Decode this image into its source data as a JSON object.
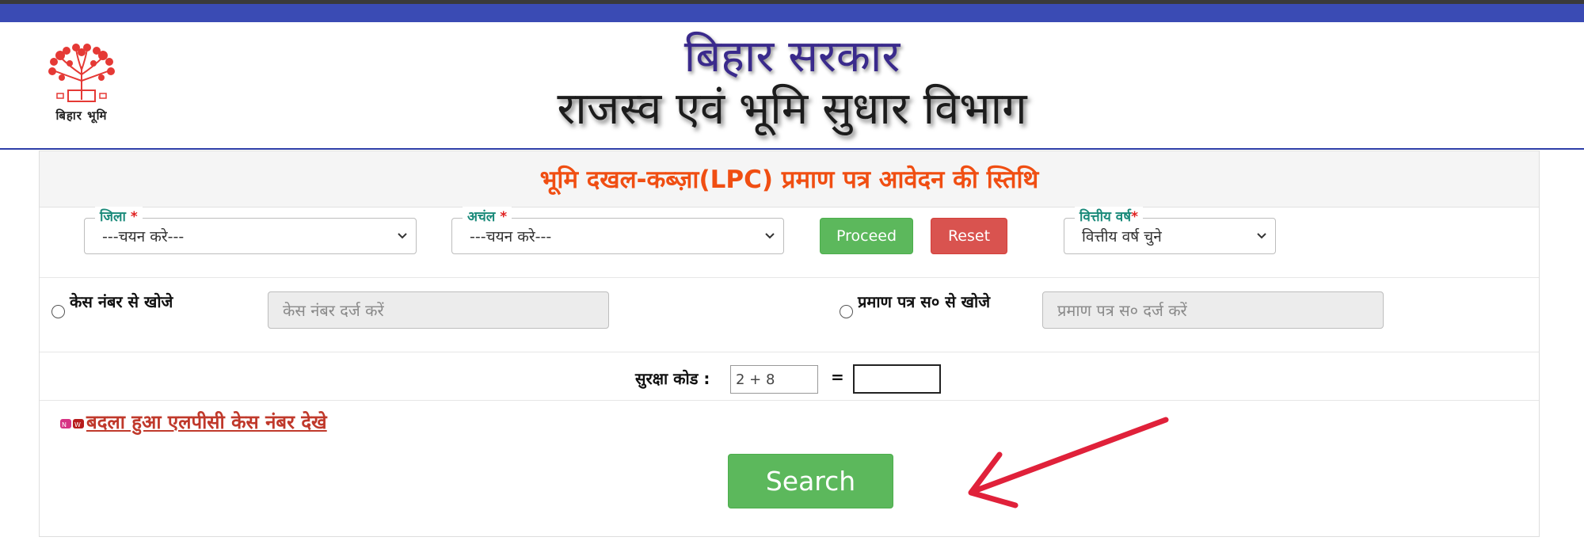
{
  "header": {
    "title_line1": "बिहार सरकार",
    "title_line2": "राजस्व एवं भूमि सुधार विभाग",
    "logo_text": "बिहार भूमि",
    "logo_icon": "tree-emblem-icon",
    "bar_color": "#3a4bb4"
  },
  "form": {
    "title": "भूमि दखल-कब्ज़ा(LPC) प्रमाण पत्र आवेदन की स्तिथि",
    "district": {
      "label": "जिला",
      "required_mark": "*",
      "value": "---चयन करे---"
    },
    "circle": {
      "label": "अचंल",
      "required_mark": "*",
      "value": "---चयन करे---"
    },
    "proceed_label": "Proceed",
    "reset_label": "Reset",
    "fin_year": {
      "label": "वित्तीय वर्ष",
      "required_mark": "*",
      "value": "वित्तीय वर्ष चुने"
    },
    "case_search": {
      "label": "केस नंबर से खोजे",
      "placeholder": "केस नंबर दर्ज करें"
    },
    "cert_search": {
      "label": "प्रमाण पत्र स० से खोजे",
      "placeholder": "प्रमाण पत्र स० दर्ज करें"
    },
    "captcha": {
      "label": "सुरक्षा कोड :",
      "question": "2 + 8",
      "equals": "="
    },
    "changed_link": "बदला हुआ एलपीसी केस नंबर देखे",
    "search_label": "Search"
  },
  "colors": {
    "title_accent": "#f04e12",
    "label_teal": "#1a8a7a",
    "green_button": "#5cb85c",
    "red_button": "#d9534f",
    "annotation_arrow": "#e0213a"
  }
}
